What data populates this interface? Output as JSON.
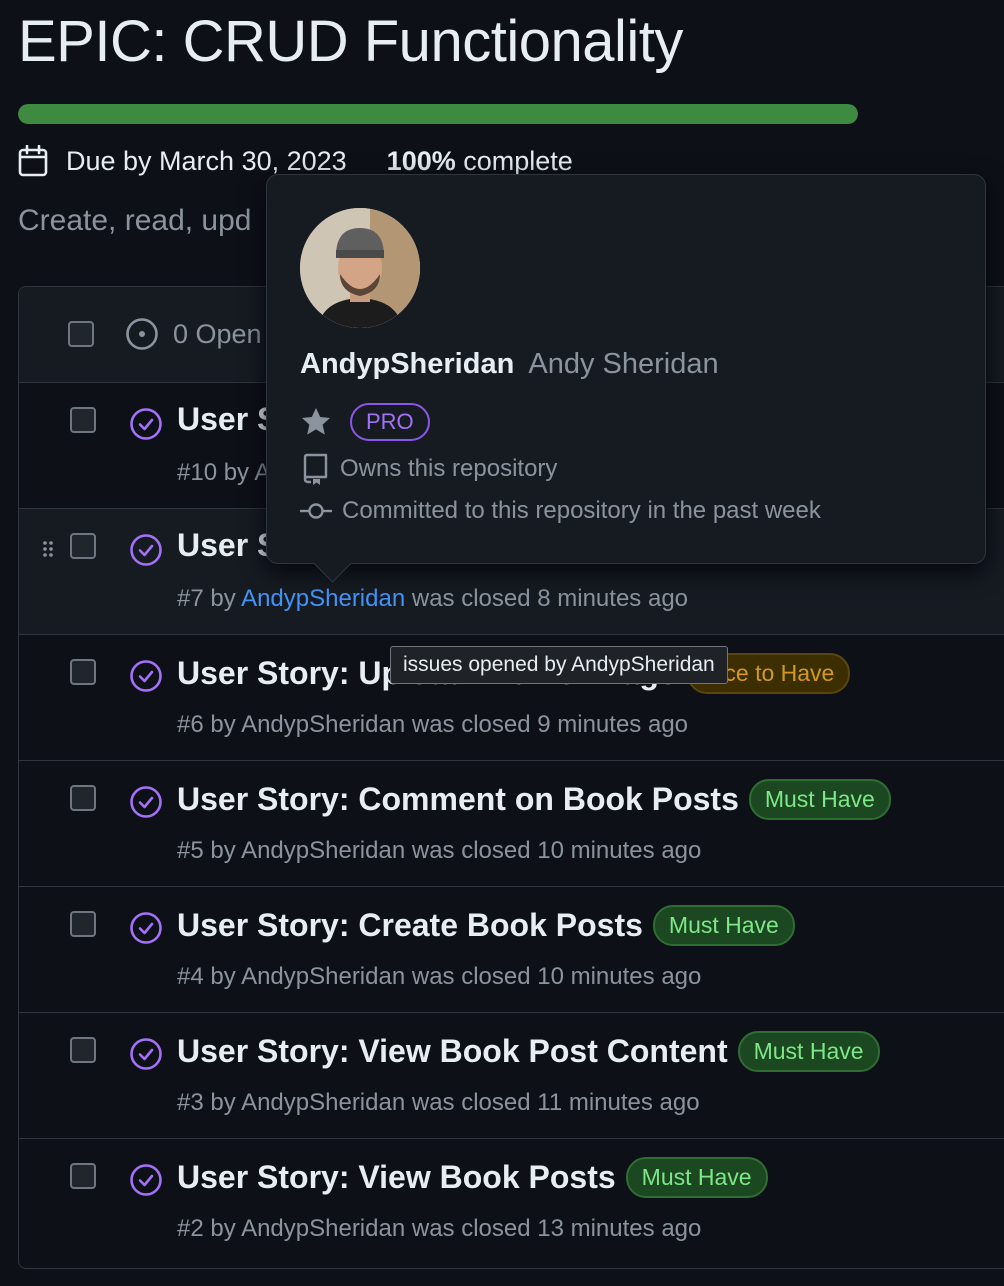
{
  "milestone": {
    "title": "EPIC: CRUD Functionality",
    "progress_fraction": 1.0,
    "due": "Due by March 30, 2023",
    "complete_percent": "100%",
    "complete_word": "complete",
    "description": "Create, read, upd",
    "colors": {
      "progress": "#3e8a40",
      "background": "#0d1117"
    }
  },
  "list_header": {
    "open_text": "0 Open"
  },
  "issues": [
    {
      "title": "User S",
      "meta_prefix": "#10 by ",
      "author": "A",
      "meta_suffix": "",
      "labels": []
    },
    {
      "title": "User S",
      "meta_prefix": "#7 by ",
      "author": "AndypSheridan",
      "meta_suffix": " was closed 8 minutes ago",
      "labels": []
    },
    {
      "title": "User Story: Upload Profile Image",
      "meta_prefix": "#6 by ",
      "author": "AndypSheridan",
      "meta_suffix": " was closed 9 minutes ago",
      "labels": [
        "Nice to Have"
      ]
    },
    {
      "title": "User Story: Comment on Book Posts",
      "meta_prefix": "#5 by ",
      "author": "AndypSheridan",
      "meta_suffix": " was closed 10 minutes ago",
      "labels": [
        "Must Have"
      ]
    },
    {
      "title": "User Story: Create Book Posts",
      "meta_prefix": "#4 by ",
      "author": "AndypSheridan",
      "meta_suffix": " was closed 10 minutes ago",
      "labels": [
        "Must Have"
      ]
    },
    {
      "title": "User Story: View Book Post Content",
      "meta_prefix": "#3 by ",
      "author": "AndypSheridan",
      "meta_suffix": " was closed 11 minutes ago",
      "labels": [
        "Must Have"
      ]
    },
    {
      "title": "User Story: View Book Posts",
      "meta_prefix": "#2 by ",
      "author": "AndypSheridan",
      "meta_suffix": " was closed 13 minutes ago",
      "labels": [
        "Must Have"
      ]
    }
  ],
  "hovercard": {
    "login": "AndypSheridan",
    "full_name": "Andy Sheridan",
    "pro_badge": "PRO",
    "owns_text": "Owns this repository",
    "committed_text": "Committed to this repository in the past week"
  },
  "tooltip": {
    "text": "issues opened by AndypSheridan"
  },
  "icons": {
    "calendar": "calendar-icon",
    "open_issue": "issue-opened-icon",
    "closed_issue": "issue-closed-icon",
    "star": "star-icon",
    "repo": "repo-icon",
    "commit": "git-commit-icon",
    "drag": "grabber-icon"
  }
}
